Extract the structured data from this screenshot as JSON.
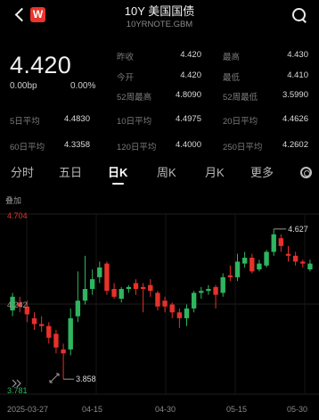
{
  "header": {
    "title": "10Y 美国国债",
    "subtitle": "10YRNOTE.GBM",
    "logo_letter": "W"
  },
  "quote": {
    "price": "4.420",
    "change_bp": "0.00bp",
    "change_pct": "0.00%"
  },
  "stats": {
    "prev_close_label": "昨收",
    "prev_close": "4.420",
    "open_label": "今开",
    "open": "4.420",
    "high_label": "最高",
    "high": "4.430",
    "low_label": "最低",
    "low": "4.410",
    "w52_high_label": "52周最高",
    "w52_high": "4.8090",
    "w52_low_label": "52周最低",
    "w52_low": "3.5990",
    "ma5_label": "5日平均",
    "ma5": "4.4830",
    "ma10_label": "10日平均",
    "ma10": "4.4975",
    "ma20_label": "20日平均",
    "ma20": "4.4626",
    "ma60_label": "60日平均",
    "ma60": "4.3358",
    "ma120_label": "120日平均",
    "ma120": "4.4000",
    "ma250_label": "250日平均",
    "ma250": "4.2602"
  },
  "tabs": [
    "分时",
    "五日",
    "日K",
    "周K",
    "月K",
    "更多"
  ],
  "active_tab": "日K",
  "chart": {
    "overlay_label": "叠加",
    "ymax_label": "4.704",
    "ymin_label": "3.781",
    "mid_label": "4.242",
    "high_marker": "4.627",
    "low_marker": "3.858",
    "x_labels": [
      "2025-03-27",
      "04-15",
      "04-30",
      "05-15",
      "05-30"
    ],
    "up_color": "#2fb55f",
    "down_color": "#e6312b"
  },
  "chart_data": {
    "type": "candlestick",
    "ylim": [
      3.781,
      4.704
    ],
    "x": [
      "2025-03-27",
      "04-15",
      "04-30",
      "05-15",
      "05-30"
    ],
    "candles": [
      {
        "o": 4.21,
        "c": 4.28,
        "h": 4.3,
        "l": 4.18,
        "up": true
      },
      {
        "o": 4.25,
        "c": 4.23,
        "h": 4.28,
        "l": 4.2,
        "up": false
      },
      {
        "o": 4.23,
        "c": 4.19,
        "h": 4.26,
        "l": 4.15,
        "up": false
      },
      {
        "o": 4.17,
        "c": 4.14,
        "h": 4.2,
        "l": 4.11,
        "up": false
      },
      {
        "o": 4.14,
        "c": 4.13,
        "h": 4.18,
        "l": 4.1,
        "up": false
      },
      {
        "o": 4.13,
        "c": 4.07,
        "h": 4.15,
        "l": 4.04,
        "up": false
      },
      {
        "o": 4.09,
        "c": 4.02,
        "h": 4.11,
        "l": 3.99,
        "up": false
      },
      {
        "o": 4.01,
        "c": 3.99,
        "h": 4.04,
        "l": 3.858,
        "up": false
      },
      {
        "o": 4.01,
        "c": 4.17,
        "h": 4.22,
        "l": 3.98,
        "up": true
      },
      {
        "o": 4.18,
        "c": 4.26,
        "h": 4.41,
        "l": 4.15,
        "up": true
      },
      {
        "o": 4.26,
        "c": 4.32,
        "h": 4.49,
        "l": 4.24,
        "up": true
      },
      {
        "o": 4.32,
        "c": 4.37,
        "h": 4.42,
        "l": 4.29,
        "up": true
      },
      {
        "o": 4.38,
        "c": 4.43,
        "h": 4.46,
        "l": 4.35,
        "up": true
      },
      {
        "o": 4.45,
        "c": 4.31,
        "h": 4.46,
        "l": 4.29,
        "up": false
      },
      {
        "o": 4.32,
        "c": 4.28,
        "h": 4.35,
        "l": 4.27,
        "up": false
      },
      {
        "o": 4.27,
        "c": 4.32,
        "h": 4.33,
        "l": 4.25,
        "up": true
      },
      {
        "o": 4.32,
        "c": 4.33,
        "h": 4.34,
        "l": 4.3,
        "up": true
      },
      {
        "o": 4.35,
        "c": 4.32,
        "h": 4.37,
        "l": 4.29,
        "up": false
      },
      {
        "o": 4.33,
        "c": 4.32,
        "h": 4.35,
        "l": 4.2,
        "up": false
      },
      {
        "o": 4.34,
        "c": 4.31,
        "h": 4.37,
        "l": 4.28,
        "up": false
      },
      {
        "o": 4.3,
        "c": 4.23,
        "h": 4.31,
        "l": 4.21,
        "up": false
      },
      {
        "o": 4.26,
        "c": 4.23,
        "h": 4.28,
        "l": 4.2,
        "up": false
      },
      {
        "o": 4.24,
        "c": 4.2,
        "h": 4.25,
        "l": 4.17,
        "up": false
      },
      {
        "o": 4.2,
        "c": 4.17,
        "h": 4.22,
        "l": 4.12,
        "up": false
      },
      {
        "o": 4.17,
        "c": 4.22,
        "h": 4.24,
        "l": 4.13,
        "up": true
      },
      {
        "o": 4.22,
        "c": 4.3,
        "h": 4.31,
        "l": 4.2,
        "up": true
      },
      {
        "o": 4.3,
        "c": 4.31,
        "h": 4.33,
        "l": 4.27,
        "up": true
      },
      {
        "o": 4.31,
        "c": 4.32,
        "h": 4.34,
        "l": 4.29,
        "up": true
      },
      {
        "o": 4.33,
        "c": 4.29,
        "h": 4.34,
        "l": 4.22,
        "up": false
      },
      {
        "o": 4.3,
        "c": 4.38,
        "h": 4.4,
        "l": 4.28,
        "up": true
      },
      {
        "o": 4.39,
        "c": 4.38,
        "h": 4.44,
        "l": 4.36,
        "up": false
      },
      {
        "o": 4.38,
        "c": 4.46,
        "h": 4.5,
        "l": 4.36,
        "up": true
      },
      {
        "o": 4.45,
        "c": 4.48,
        "h": 4.51,
        "l": 4.43,
        "up": true
      },
      {
        "o": 4.48,
        "c": 4.41,
        "h": 4.5,
        "l": 4.4,
        "up": false
      },
      {
        "o": 4.42,
        "c": 4.45,
        "h": 4.47,
        "l": 4.41,
        "up": true
      },
      {
        "o": 4.44,
        "c": 4.51,
        "h": 4.52,
        "l": 4.43,
        "up": true
      },
      {
        "o": 4.51,
        "c": 4.6,
        "h": 4.627,
        "l": 4.49,
        "up": true
      },
      {
        "o": 4.58,
        "c": 4.54,
        "h": 4.6,
        "l": 4.51,
        "up": false
      },
      {
        "o": 4.5,
        "c": 4.49,
        "h": 4.54,
        "l": 4.46,
        "up": false
      },
      {
        "o": 4.49,
        "c": 4.46,
        "h": 4.51,
        "l": 4.44,
        "up": false
      },
      {
        "o": 4.46,
        "c": 4.45,
        "h": 4.47,
        "l": 4.43,
        "up": false
      },
      {
        "o": 4.45,
        "c": 4.42,
        "h": 4.47,
        "l": 4.41,
        "up": true
      }
    ]
  }
}
